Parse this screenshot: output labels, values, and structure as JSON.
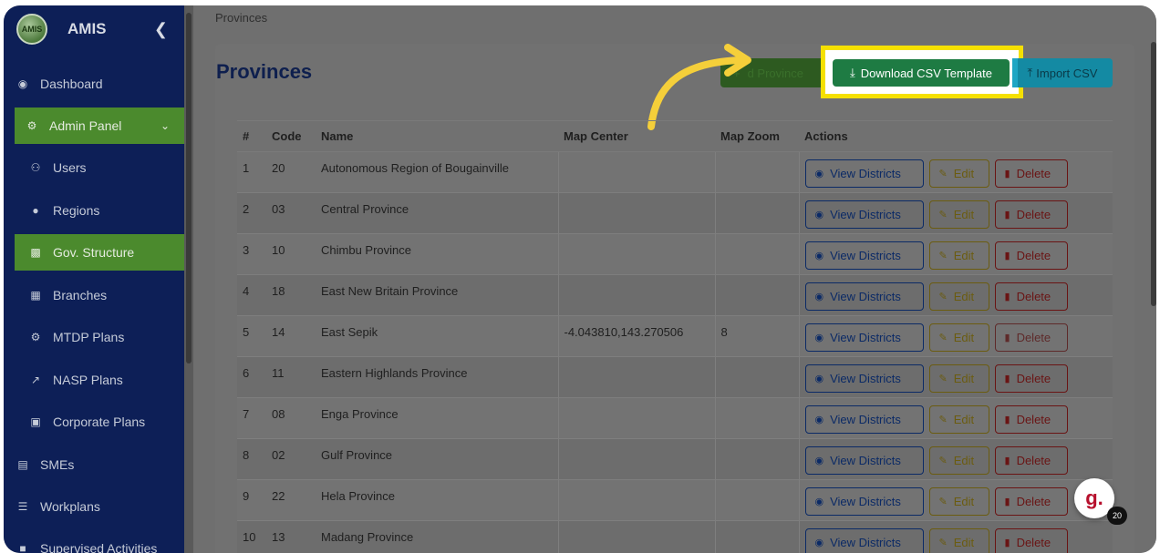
{
  "sidebar": {
    "logo": "AMIS",
    "brand": "AMIS",
    "items": [
      {
        "label": "Dashboard",
        "icon": "dashboard-icon"
      },
      {
        "label": "Admin Panel",
        "icon": "gear-icon"
      },
      {
        "label": "Users",
        "icon": "users-icon"
      },
      {
        "label": "Regions",
        "icon": "map-pin-icon"
      },
      {
        "label": "Gov. Structure",
        "icon": "hierarchy-icon"
      },
      {
        "label": "Branches",
        "icon": "building-icon"
      },
      {
        "label": "MTDP Plans",
        "icon": "project-diagram-icon"
      },
      {
        "label": "NASP Plans",
        "icon": "chart-line-icon"
      },
      {
        "label": "Corporate Plans",
        "icon": "briefcase-icon"
      },
      {
        "label": "SMEs",
        "icon": "store-icon"
      },
      {
        "label": "Workplans",
        "icon": "list-icon"
      },
      {
        "label": "Supervised Activities",
        "icon": "clipboard-icon"
      }
    ]
  },
  "breadcrumb": "Provinces",
  "page": {
    "title": "Provinces",
    "add_label": "d Province",
    "download_label": "Download CSV Template",
    "import_label": "Import CSV"
  },
  "table": {
    "headers": [
      "#",
      "Code",
      "Name",
      "Map Center",
      "Map Zoom",
      "Actions"
    ],
    "rows": [
      {
        "num": "1",
        "code": "20",
        "name": "Autonomous Region of Bougainville",
        "center": "",
        "zoom": ""
      },
      {
        "num": "2",
        "code": "03",
        "name": "Central Province",
        "center": "",
        "zoom": ""
      },
      {
        "num": "3",
        "code": "10",
        "name": "Chimbu Province",
        "center": "",
        "zoom": ""
      },
      {
        "num": "4",
        "code": "18",
        "name": "East New Britain Province",
        "center": "",
        "zoom": ""
      },
      {
        "num": "5",
        "code": "14",
        "name": "East Sepik",
        "center": "-4.043810,143.270506",
        "zoom": "8"
      },
      {
        "num": "6",
        "code": "11",
        "name": "Eastern Highlands Province",
        "center": "",
        "zoom": ""
      },
      {
        "num": "7",
        "code": "08",
        "name": "Enga Province",
        "center": "",
        "zoom": ""
      },
      {
        "num": "8",
        "code": "02",
        "name": "Gulf Province",
        "center": "",
        "zoom": ""
      },
      {
        "num": "9",
        "code": "22",
        "name": "Hela Province",
        "center": "",
        "zoom": ""
      },
      {
        "num": "10",
        "code": "13",
        "name": "Madang Province",
        "center": "",
        "zoom": ""
      }
    ],
    "actions": {
      "view": "View Districts",
      "edit": "Edit",
      "delete": "Delete"
    }
  },
  "fab": {
    "letter": "g.",
    "badge": "20"
  },
  "colors": {
    "sidebar": "#0d1f57",
    "active": "#4b8a2d",
    "highlight": "#f5e000",
    "download": "#1e7b43",
    "import": "#148aa3"
  }
}
